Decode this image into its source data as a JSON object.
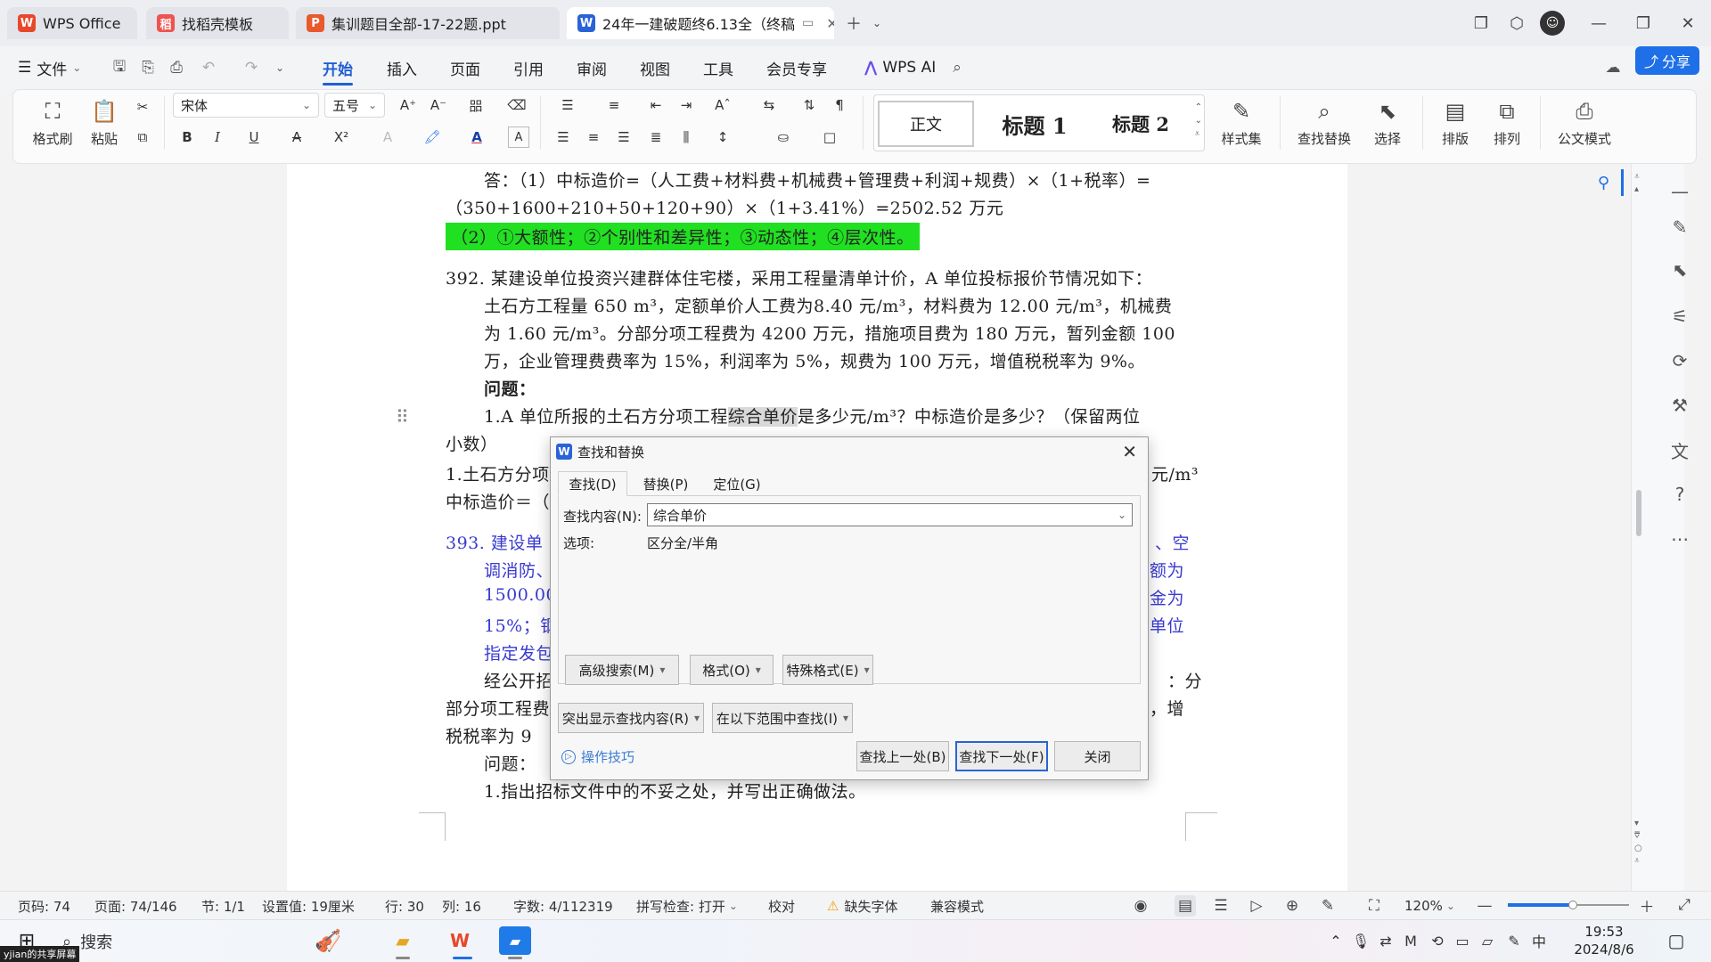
{
  "tabs": [
    {
      "label": "WPS Office",
      "icon": "W",
      "color": "#e8472b"
    },
    {
      "label": "找稻壳模板",
      "icon": "稻",
      "color": "#ef5350"
    },
    {
      "label": "集训题目全部-17-22题.ppt",
      "icon": "P",
      "color": "#e8592b"
    },
    {
      "label": "24年一建破题终6.13全（终稿",
      "icon": "W",
      "color": "#2a63d6"
    }
  ],
  "menu": {
    "file": "文件",
    "items": [
      "开始",
      "插入",
      "页面",
      "引用",
      "审阅",
      "视图",
      "工具",
      "会员专享"
    ],
    "active_index": 0,
    "wps_ai": "WPS AI",
    "share": "分享"
  },
  "ribbon": {
    "format_painter": "格式刷",
    "paste": "粘贴",
    "font_name": "宋体",
    "font_size": "五号",
    "styles": [
      "正文",
      "标题 1",
      "标题 2"
    ],
    "style_set": "样式集",
    "find_replace": "查找替换",
    "select": "选择",
    "layout": "排版",
    "arrange": "排列",
    "official_doc": "公文模式"
  },
  "document": {
    "lines": [
      {
        "text": "答：（1）中标造价=（人工费+材料费+机械费+管理费+利润+规费）×（1+税率）="
      },
      {
        "text": "（350+1600+210+50+120+90）×（1+3.41%）=2502.52 万元"
      },
      {
        "text": "（2）①大额性；②个别性和差异性；③动态性；④层次性。"
      },
      {
        "text": "392. 某建设单位投资兴建群体住宅楼，采用工程量清单计价，A 单位投标报价节情况如下："
      },
      {
        "text": "土石方工程量 650 m³，定额单价人工费为8.40 元/m³，材料费为 12.00 元/m³，机械费"
      },
      {
        "text": "为 1.60 元/m³。分部分项工程费为 4200 万元，措施项目费为 180 万元，暂列金额 100"
      },
      {
        "text": "万，企业管理费费率为 15%，利润率为 5%，规费为 100 万元，增值税税率为 9%。"
      },
      {
        "text": "问题："
      },
      {
        "pre": "1.A 单位所报的土石方分项工程",
        "hl": "综合单价",
        "post": "是多少元/m³？中标造价是多少？（保留两位"
      },
      {
        "text": "小数）"
      },
      {
        "left": "1.土石方分项",
        "right": "元/m³"
      },
      {
        "left": "中标造价＝（"
      },
      {
        "left": "393. 建设单",
        "right": "、空"
      },
      {
        "left": "调消防、",
        "right": "额为"
      },
      {
        "left": "1500.00",
        "right": "金为"
      },
      {
        "left": "15%；钢",
        "right": "单位"
      },
      {
        "left": "指定发包"
      },
      {
        "left": "经公开招",
        "right": "：分"
      },
      {
        "left": "部分项工程费",
        "right": "，增"
      },
      {
        "left": "税税率为 9"
      },
      {
        "text": "问题："
      },
      {
        "text": "1.指出招标文件中的不妥之处，并写出正确做法。"
      }
    ]
  },
  "dialog": {
    "title": "查找和替换",
    "tabs": [
      "查找(D)",
      "替换(P)",
      "定位(G)"
    ],
    "find_label": "查找内容(N):",
    "find_value": "综合单价",
    "options_label": "选项:",
    "options_value": "区分全/半角",
    "advanced_search": "高级搜索(M)",
    "format": "格式(O)",
    "special_format": "特殊格式(E)",
    "highlight": "突出显示查找内容(R)",
    "find_in": "在以下范围中查找(I)",
    "tips": "操作技巧",
    "find_prev": "查找上一处(B)",
    "find_next": "查找下一处(F)",
    "close": "关闭"
  },
  "status": {
    "page": "页码: 74",
    "pages": "页面: 74/146",
    "section": "节: 1/1",
    "setting": "设置值: 19厘米",
    "row": "行: 30",
    "col": "列: 16",
    "words": "字数: 4/112319",
    "spell": "拼写检查: 打开",
    "proof": "校对",
    "missing_font": "缺失字体",
    "compat": "兼容模式",
    "zoom": "120%",
    "zoom_level": 0.54
  },
  "taskbar": {
    "search": "搜索",
    "time": "19:53",
    "date": "2024/8/6",
    "share_tag": "yjian的共享屏幕",
    "ime": "中"
  }
}
